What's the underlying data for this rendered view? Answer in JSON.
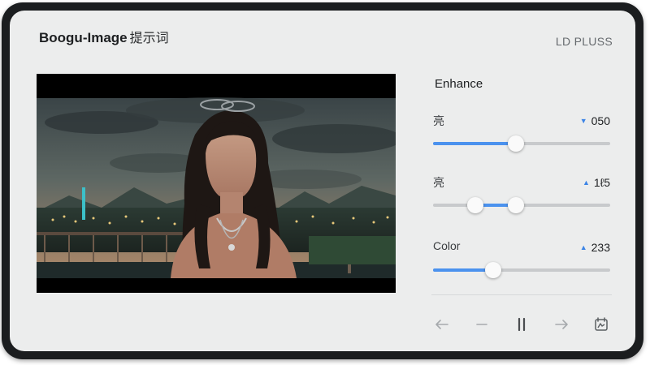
{
  "header": {
    "app_name": "Boogu-Image",
    "app_suffix": "提示词",
    "brand": "LD PLUSS"
  },
  "panel": {
    "title": "Enhance",
    "adjustments": [
      {
        "label": "亮",
        "value": "050",
        "indicator": "down-arrow-icon",
        "slider": {
          "fraction": 0.47
        }
      },
      {
        "label": "亮",
        "value": "1ℓ5",
        "indicator": "up-arrow-icon",
        "slider": {
          "range_start": 0.24,
          "range_end": 0.47
        }
      },
      {
        "label": "Color",
        "value": "233",
        "indicator": "up-arrow-icon",
        "slider": {
          "fraction": 0.34
        }
      }
    ]
  },
  "controls": [
    {
      "name": "back-arrow-icon",
      "enabled": false
    },
    {
      "name": "minus-icon",
      "enabled": false
    },
    {
      "name": "pause-icon",
      "enabled": true
    },
    {
      "name": "forward-arrow-icon",
      "enabled": false
    },
    {
      "name": "compare-icon",
      "enabled": true
    }
  ],
  "colors": {
    "accent": "#4b92ee",
    "screen_background": "#eceded",
    "bezel": "#1b1d1f"
  }
}
